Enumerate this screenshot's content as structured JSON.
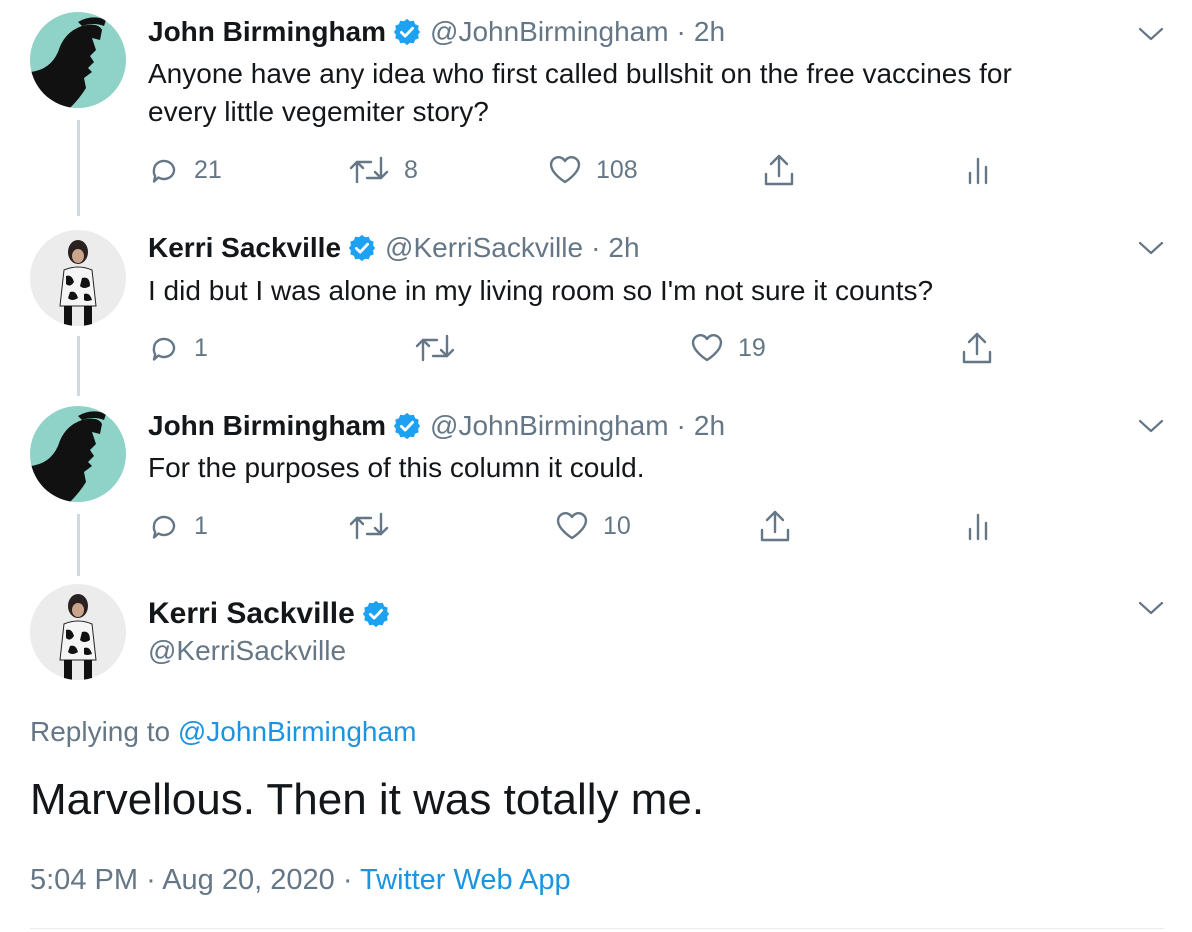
{
  "colors": {
    "text": "#14171a",
    "secondary": "#657786",
    "link": "#1b95e0",
    "verified": "#1da1f2",
    "thread_line": "#cfd9de",
    "avatar_teal": "#8fd3c8"
  },
  "tweets": [
    {
      "name": "John Birmingham",
      "handle": "@JohnBirmingham",
      "dot": "·",
      "time": "2h",
      "text": [
        "Anyone have any idea who first called bullshit on the free vaccines for",
        "every little vegemiter story?"
      ],
      "replies": "21",
      "retweets": "8",
      "likes": "108",
      "avatar_icon": "jb-silhouette-avatar"
    },
    {
      "name": "Kerri Sackville",
      "handle": "@KerriSackville",
      "dot": "·",
      "time": "2h",
      "text": [
        "I did but I was alone in my living room so I'm not sure it counts?"
      ],
      "replies": "1",
      "retweets": "",
      "likes": "19",
      "avatar_icon": "ks-photo-avatar"
    },
    {
      "name": "John Birmingham",
      "handle": "@JohnBirmingham",
      "dot": "·",
      "time": "2h",
      "text": [
        "For the purposes of this column it could."
      ],
      "replies": "1",
      "retweets": "",
      "likes": "10",
      "avatar_icon": "jb-silhouette-avatar"
    }
  ],
  "focused_tweet": {
    "name": "Kerri Sackville",
    "handle": "@KerriSackville",
    "replying_prefix": "Replying to ",
    "replying_to": "@JohnBirmingham",
    "text": "Marvellous. Then it was totally me.",
    "time": "5:04 PM",
    "dot": "·",
    "date": "Aug 20, 2020",
    "source": "Twitter Web App"
  }
}
